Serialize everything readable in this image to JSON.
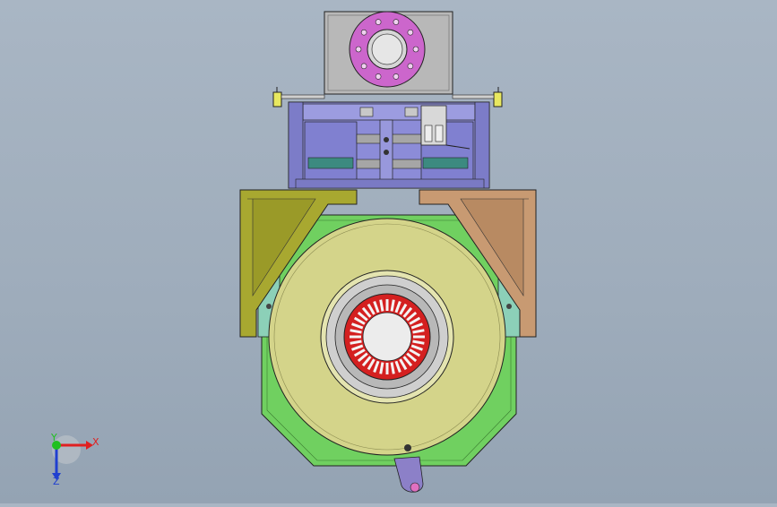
{
  "viewport": {
    "background_top": "#a9b6c4",
    "background_bottom": "#94a3b3"
  },
  "triad": {
    "x_label": "X",
    "y_label": "Y",
    "z_label": "Z",
    "x_color": "#e02020",
    "y_color": "#20c020",
    "z_color": "#2040d0"
  },
  "colors": {
    "flange": "#cc66cc",
    "top_block": "#b4b4b4",
    "cylinder_assembly": "#8c8cd8",
    "left_bracket": "#a8a830",
    "right_bracket": "#c89a72",
    "base_plate": "#70d060",
    "housing_disk": "#d4d48a",
    "stator_core": "#d42020",
    "teal_plates": "#8cd0b8",
    "lever": "#8c80c8"
  },
  "model": {
    "stator_slots": 36,
    "flange_bolts": 10
  }
}
